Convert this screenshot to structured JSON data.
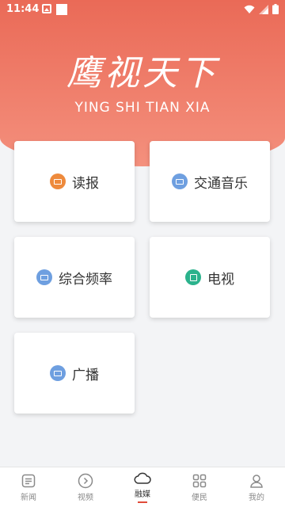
{
  "status": {
    "time": "11:44"
  },
  "header": {
    "title_cn": "鹰视天下",
    "title_en": "YING SHI TIAN XIA"
  },
  "cards": [
    {
      "label": "读报",
      "icon": "newspaper-icon",
      "color": "#ee8a3c"
    },
    {
      "label": "交通音乐",
      "icon": "radio-icon",
      "color": "#6e9fe0"
    },
    {
      "label": "综合频率",
      "icon": "radio-icon",
      "color": "#6e9fe0"
    },
    {
      "label": "电视",
      "icon": "tv-icon",
      "color": "#2bb28c"
    },
    {
      "label": "广播",
      "icon": "radio-icon",
      "color": "#6e9fe0"
    }
  ],
  "tabs": [
    {
      "label": "新闻",
      "icon": "news-icon"
    },
    {
      "label": "视频",
      "icon": "play-circle-icon"
    },
    {
      "label": "融媒",
      "icon": "cloud-icon",
      "active": true
    },
    {
      "label": "便民",
      "icon": "grid-icon"
    },
    {
      "label": "我的",
      "icon": "user-icon"
    }
  ],
  "colors": {
    "hero_top": "#ea6a57",
    "hero_bottom": "#f4907d",
    "active_tab_underline": "#e04b3a"
  }
}
